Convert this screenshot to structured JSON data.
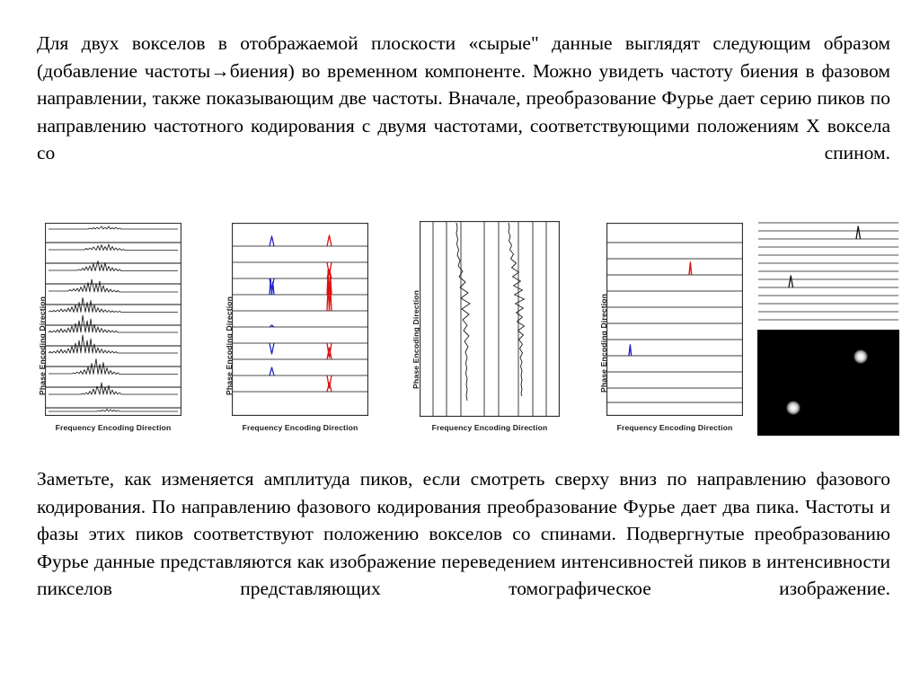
{
  "document": {
    "background_color": "#ffffff",
    "text_color": "#000000"
  },
  "paragraph_top": {
    "text": "Для двух вокселов в отображаемой плоскости «сырые\" данные выглядят следующим образом (добавление частоты→биения) во временном компоненте. Можно увидеть частоту биения в фазовом направлении, также показывающим две частоты. Вначале, преобразование Фурье дает серию пиков по направлению частотного кодирования с двумя частотами, соответствующими положениям X воксела со спином."
  },
  "paragraph_bottom": {
    "text": "Заметьте, как изменяется амплитуда пиков, если смотреть сверху вниз по направлению фазового кодирования. По направлению фазового кодирования преобразование Фурье дает два пика. Частоты и фазы этих пиков соответствуют положению вокселов со спинами. Подвергнутые преобразованию Фурье данные представляются как изображение переведением интенсивностей пиков в интенсивности пикселов представляющих томографическое изображение."
  },
  "figures": {
    "axis_labels": {
      "x": "Frequency Encoding Direction",
      "y": "Phase Encoding Direction"
    },
    "colors": {
      "blue_peak": "#2222cc",
      "red_peak": "#dd1111",
      "trace": "#222222",
      "gridline": "#4d4d4d",
      "border": "#333333",
      "image_background": "#000000",
      "image_spot": "#e8e8e8"
    },
    "panels": [
      {
        "id": "panel-raw-kspace",
        "name": "raw-k-space-data",
        "caption_x": "Frequency Encoding Direction",
        "caption_y": "Phase Encoding Direction",
        "rows": 10,
        "description": "raw time-domain echo traces with beat modulation"
      },
      {
        "id": "panel-ft-frequency",
        "name": "fourier-transform-frequency-direction",
        "caption_x": "Frequency Encoding Direction",
        "caption_y": "Phase Encoding Direction",
        "rows": 12,
        "blue_peak_x_pct": 31,
        "red_peak_x_pct": 72,
        "description": "two series of peaks, blue left and red right, alternating sign"
      },
      {
        "id": "panel-phase-beats",
        "name": "phase-direction-beat-traces",
        "caption_x": "Frequency Encoding Direction",
        "caption_y": "Phase Encoding Direction",
        "columns": 10,
        "description": "vertical gridlines with two oscillating vertical traces"
      },
      {
        "id": "panel-ft-2d",
        "name": "two-dimensional-fourier-transform",
        "caption_x": "Frequency Encoding Direction",
        "caption_y": "Phase Encoding Direction",
        "rows": 12,
        "red_peak": {
          "x_pct": 61,
          "row": 3
        },
        "blue_peak": {
          "x_pct": 17,
          "row": 8
        },
        "description": "single red peak upper right, single blue peak lower left"
      },
      {
        "id": "panel-image",
        "name": "reconstructed-image",
        "rows": 13,
        "peaks": [
          {
            "x_pct": 72,
            "row": 1
          },
          {
            "x_pct": 24,
            "row": 7
          }
        ],
        "spots": [
          {
            "x_pct": 73,
            "y_pct": 25
          },
          {
            "x_pct": 25,
            "y_pct": 74
          }
        ],
        "description": "grey-line peak plot above a black reconstructed slice with two bright voxels"
      }
    ]
  }
}
